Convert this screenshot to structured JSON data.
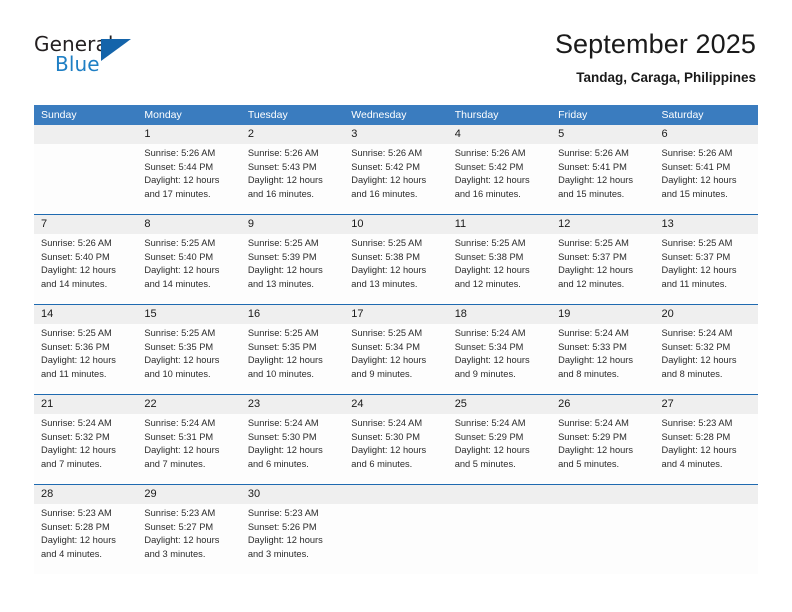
{
  "brand": {
    "name_top": "General",
    "name_bottom": "Blue",
    "accent_color": "#1f7fc4",
    "triangle_color": "#1464aa"
  },
  "header": {
    "title": "September 2025",
    "subtitle": "Tandag, Caraga, Philippines"
  },
  "calendar": {
    "header_bg": "#3a7cbf",
    "week_rule_color": "#1f6ab0",
    "daynum_bg": "#efefef",
    "weekdays": [
      "Sunday",
      "Monday",
      "Tuesday",
      "Wednesday",
      "Thursday",
      "Friday",
      "Saturday"
    ],
    "weeks": [
      {
        "days": [
          {
            "day": "",
            "sunrise": "",
            "sunset": "",
            "daylight_line1": "",
            "daylight_line2": ""
          },
          {
            "day": "1",
            "sunrise": "Sunrise: 5:26 AM",
            "sunset": "Sunset: 5:44 PM",
            "daylight_line1": "Daylight: 12 hours",
            "daylight_line2": "and 17 minutes."
          },
          {
            "day": "2",
            "sunrise": "Sunrise: 5:26 AM",
            "sunset": "Sunset: 5:43 PM",
            "daylight_line1": "Daylight: 12 hours",
            "daylight_line2": "and 16 minutes."
          },
          {
            "day": "3",
            "sunrise": "Sunrise: 5:26 AM",
            "sunset": "Sunset: 5:42 PM",
            "daylight_line1": "Daylight: 12 hours",
            "daylight_line2": "and 16 minutes."
          },
          {
            "day": "4",
            "sunrise": "Sunrise: 5:26 AM",
            "sunset": "Sunset: 5:42 PM",
            "daylight_line1": "Daylight: 12 hours",
            "daylight_line2": "and 16 minutes."
          },
          {
            "day": "5",
            "sunrise": "Sunrise: 5:26 AM",
            "sunset": "Sunset: 5:41 PM",
            "daylight_line1": "Daylight: 12 hours",
            "daylight_line2": "and 15 minutes."
          },
          {
            "day": "6",
            "sunrise": "Sunrise: 5:26 AM",
            "sunset": "Sunset: 5:41 PM",
            "daylight_line1": "Daylight: 12 hours",
            "daylight_line2": "and 15 minutes."
          }
        ]
      },
      {
        "days": [
          {
            "day": "7",
            "sunrise": "Sunrise: 5:26 AM",
            "sunset": "Sunset: 5:40 PM",
            "daylight_line1": "Daylight: 12 hours",
            "daylight_line2": "and 14 minutes."
          },
          {
            "day": "8",
            "sunrise": "Sunrise: 5:25 AM",
            "sunset": "Sunset: 5:40 PM",
            "daylight_line1": "Daylight: 12 hours",
            "daylight_line2": "and 14 minutes."
          },
          {
            "day": "9",
            "sunrise": "Sunrise: 5:25 AM",
            "sunset": "Sunset: 5:39 PM",
            "daylight_line1": "Daylight: 12 hours",
            "daylight_line2": "and 13 minutes."
          },
          {
            "day": "10",
            "sunrise": "Sunrise: 5:25 AM",
            "sunset": "Sunset: 5:38 PM",
            "daylight_line1": "Daylight: 12 hours",
            "daylight_line2": "and 13 minutes."
          },
          {
            "day": "11",
            "sunrise": "Sunrise: 5:25 AM",
            "sunset": "Sunset: 5:38 PM",
            "daylight_line1": "Daylight: 12 hours",
            "daylight_line2": "and 12 minutes."
          },
          {
            "day": "12",
            "sunrise": "Sunrise: 5:25 AM",
            "sunset": "Sunset: 5:37 PM",
            "daylight_line1": "Daylight: 12 hours",
            "daylight_line2": "and 12 minutes."
          },
          {
            "day": "13",
            "sunrise": "Sunrise: 5:25 AM",
            "sunset": "Sunset: 5:37 PM",
            "daylight_line1": "Daylight: 12 hours",
            "daylight_line2": "and 11 minutes."
          }
        ]
      },
      {
        "days": [
          {
            "day": "14",
            "sunrise": "Sunrise: 5:25 AM",
            "sunset": "Sunset: 5:36 PM",
            "daylight_line1": "Daylight: 12 hours",
            "daylight_line2": "and 11 minutes."
          },
          {
            "day": "15",
            "sunrise": "Sunrise: 5:25 AM",
            "sunset": "Sunset: 5:35 PM",
            "daylight_line1": "Daylight: 12 hours",
            "daylight_line2": "and 10 minutes."
          },
          {
            "day": "16",
            "sunrise": "Sunrise: 5:25 AM",
            "sunset": "Sunset: 5:35 PM",
            "daylight_line1": "Daylight: 12 hours",
            "daylight_line2": "and 10 minutes."
          },
          {
            "day": "17",
            "sunrise": "Sunrise: 5:25 AM",
            "sunset": "Sunset: 5:34 PM",
            "daylight_line1": "Daylight: 12 hours",
            "daylight_line2": "and 9 minutes."
          },
          {
            "day": "18",
            "sunrise": "Sunrise: 5:24 AM",
            "sunset": "Sunset: 5:34 PM",
            "daylight_line1": "Daylight: 12 hours",
            "daylight_line2": "and 9 minutes."
          },
          {
            "day": "19",
            "sunrise": "Sunrise: 5:24 AM",
            "sunset": "Sunset: 5:33 PM",
            "daylight_line1": "Daylight: 12 hours",
            "daylight_line2": "and 8 minutes."
          },
          {
            "day": "20",
            "sunrise": "Sunrise: 5:24 AM",
            "sunset": "Sunset: 5:32 PM",
            "daylight_line1": "Daylight: 12 hours",
            "daylight_line2": "and 8 minutes."
          }
        ]
      },
      {
        "days": [
          {
            "day": "21",
            "sunrise": "Sunrise: 5:24 AM",
            "sunset": "Sunset: 5:32 PM",
            "daylight_line1": "Daylight: 12 hours",
            "daylight_line2": "and 7 minutes."
          },
          {
            "day": "22",
            "sunrise": "Sunrise: 5:24 AM",
            "sunset": "Sunset: 5:31 PM",
            "daylight_line1": "Daylight: 12 hours",
            "daylight_line2": "and 7 minutes."
          },
          {
            "day": "23",
            "sunrise": "Sunrise: 5:24 AM",
            "sunset": "Sunset: 5:30 PM",
            "daylight_line1": "Daylight: 12 hours",
            "daylight_line2": "and 6 minutes."
          },
          {
            "day": "24",
            "sunrise": "Sunrise: 5:24 AM",
            "sunset": "Sunset: 5:30 PM",
            "daylight_line1": "Daylight: 12 hours",
            "daylight_line2": "and 6 minutes."
          },
          {
            "day": "25",
            "sunrise": "Sunrise: 5:24 AM",
            "sunset": "Sunset: 5:29 PM",
            "daylight_line1": "Daylight: 12 hours",
            "daylight_line2": "and 5 minutes."
          },
          {
            "day": "26",
            "sunrise": "Sunrise: 5:24 AM",
            "sunset": "Sunset: 5:29 PM",
            "daylight_line1": "Daylight: 12 hours",
            "daylight_line2": "and 5 minutes."
          },
          {
            "day": "27",
            "sunrise": "Sunrise: 5:23 AM",
            "sunset": "Sunset: 5:28 PM",
            "daylight_line1": "Daylight: 12 hours",
            "daylight_line2": "and 4 minutes."
          }
        ]
      },
      {
        "days": [
          {
            "day": "28",
            "sunrise": "Sunrise: 5:23 AM",
            "sunset": "Sunset: 5:28 PM",
            "daylight_line1": "Daylight: 12 hours",
            "daylight_line2": "and 4 minutes."
          },
          {
            "day": "29",
            "sunrise": "Sunrise: 5:23 AM",
            "sunset": "Sunset: 5:27 PM",
            "daylight_line1": "Daylight: 12 hours",
            "daylight_line2": "and 3 minutes."
          },
          {
            "day": "30",
            "sunrise": "Sunrise: 5:23 AM",
            "sunset": "Sunset: 5:26 PM",
            "daylight_line1": "Daylight: 12 hours",
            "daylight_line2": "and 3 minutes."
          },
          {
            "day": "",
            "sunrise": "",
            "sunset": "",
            "daylight_line1": "",
            "daylight_line2": ""
          },
          {
            "day": "",
            "sunrise": "",
            "sunset": "",
            "daylight_line1": "",
            "daylight_line2": ""
          },
          {
            "day": "",
            "sunrise": "",
            "sunset": "",
            "daylight_line1": "",
            "daylight_line2": ""
          },
          {
            "day": "",
            "sunrise": "",
            "sunset": "",
            "daylight_line1": "",
            "daylight_line2": ""
          }
        ]
      }
    ]
  }
}
